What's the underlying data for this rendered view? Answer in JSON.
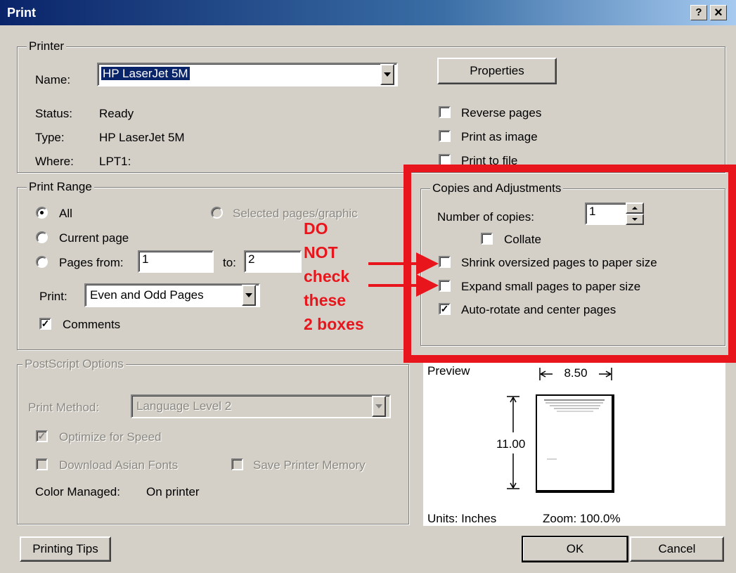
{
  "window": {
    "title": "Print",
    "help_btn": "?",
    "close_btn": "×"
  },
  "printer": {
    "legend": "Printer",
    "name_label": "Name:",
    "name_value": "HP LaserJet 5M",
    "properties_btn": "Properties",
    "status_label": "Status:",
    "status_value": "Ready",
    "type_label": "Type:",
    "type_value": "HP LaserJet 5M",
    "where_label": "Where:",
    "where_value": "LPT1:",
    "reverse_pages": "Reverse pages",
    "print_as_image": "Print as image",
    "print_to_file": "Print to file"
  },
  "range": {
    "legend": "Print Range",
    "all": "All",
    "selected": "Selected pages/graphic",
    "current": "Current page",
    "pages_from": "Pages from:",
    "from_value": "1",
    "to_label": "to:",
    "to_value": "2",
    "print_label": "Print:",
    "print_value": "Even and Odd Pages",
    "comments": "Comments"
  },
  "copies": {
    "legend": "Copies and Adjustments",
    "number_label": "Number of copies:",
    "number_value": "1",
    "collate": "Collate",
    "shrink": "Shrink oversized pages to paper size",
    "expand": "Expand small pages to paper size",
    "autorotate": "Auto-rotate and center pages"
  },
  "postscript": {
    "legend": "PostScript Options",
    "method_label": "Print Method:",
    "method_value": "Language Level 2",
    "optimize": "Optimize for Speed",
    "download_fonts": "Download Asian Fonts",
    "save_memory": "Save Printer Memory",
    "color_label": "Color Managed:",
    "color_value": "On printer"
  },
  "preview": {
    "label": "Preview",
    "width": "8.50",
    "height": "11.00",
    "units": "Units: Inches",
    "zoom": "Zoom: 100.0%"
  },
  "buttons": {
    "tips": "Printing Tips",
    "ok": "OK",
    "cancel": "Cancel"
  },
  "annotation": {
    "lines": [
      "DO",
      "NOT",
      "check",
      "these",
      "2 boxes"
    ],
    "color": "#e8161c"
  }
}
